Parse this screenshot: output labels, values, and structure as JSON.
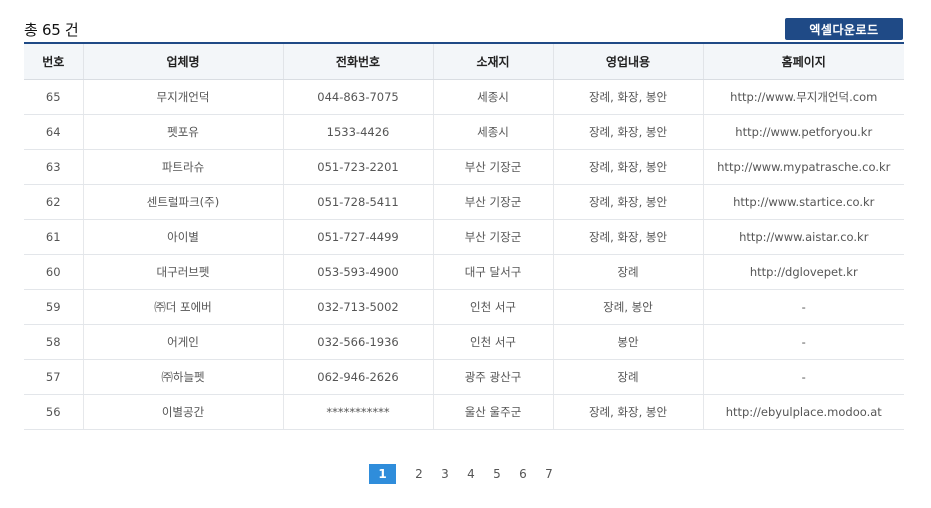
{
  "summary": {
    "total_text": "총 65 건"
  },
  "toolbar": {
    "excel_label": "엑셀다운로드"
  },
  "table": {
    "headers": [
      "번호",
      "업체명",
      "전화번호",
      "소재지",
      "영업내용",
      "홈페이지"
    ],
    "rows": [
      [
        "65",
        "무지개언덕",
        "044-863-7075",
        "세종시",
        "장례, 화장, 봉안",
        "http://www.무지개언덕.com"
      ],
      [
        "64",
        "펫포유",
        "1533-4426",
        "세종시",
        "장례, 화장, 봉안",
        "http://www.petforyou.kr"
      ],
      [
        "63",
        "파트라슈",
        "051-723-2201",
        "부산 기장군",
        "장례, 화장, 봉안",
        "http://www.mypatrasche.co.kr"
      ],
      [
        "62",
        "센트럴파크(주)",
        "051-728-5411",
        "부산 기장군",
        "장례, 화장, 봉안",
        "http://www.startice.co.kr"
      ],
      [
        "61",
        "아이별",
        "051-727-4499",
        "부산 기장군",
        "장례, 화장, 봉안",
        "http://www.aistar.co.kr"
      ],
      [
        "60",
        "대구러브펫",
        "053-593-4900",
        "대구 달서구",
        "장례",
        "http://dglovepet.kr"
      ],
      [
        "59",
        "㈜더 포에버",
        "032-713-5002",
        "인천 서구",
        "장례, 봉안",
        "-"
      ],
      [
        "58",
        "어게인",
        "032-566-1936",
        "인천 서구",
        "봉안",
        "-"
      ],
      [
        "57",
        "㈜하늘펫",
        "062-946-2626",
        "광주 광산구",
        "장례",
        "-"
      ],
      [
        "56",
        "이별공간",
        "***********",
        "울산 울주군",
        "장례, 화장, 봉안",
        "http://ebyulplace.modoo.at"
      ]
    ]
  },
  "pagination": {
    "pages": [
      "1",
      "2",
      "3",
      "4",
      "5",
      "6",
      "7"
    ],
    "current": "1"
  },
  "colors": {
    "accent": "#1f4a86",
    "active_page": "#2f8ddb",
    "header_bg": "#f3f6f9"
  }
}
